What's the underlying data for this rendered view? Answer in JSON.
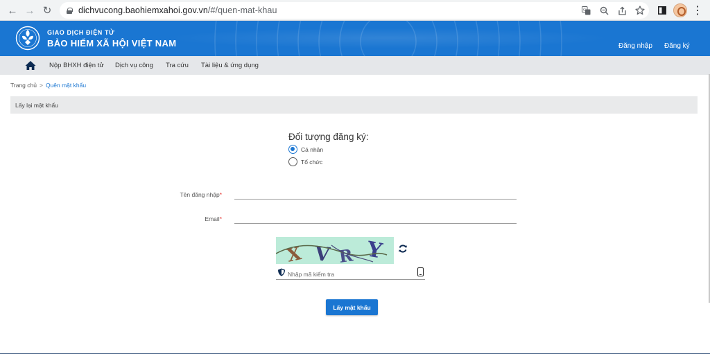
{
  "browser": {
    "url_host": "dichvucong.baohiemxahoi.gov.vn",
    "url_path": "/#/quen-mat-khau",
    "back_glyph": "←",
    "forward_glyph": "→",
    "reload_glyph": "↻",
    "menu_glyph": "⋮"
  },
  "header": {
    "brand_line1": "GIAO DỊCH ĐIỆN TỬ",
    "brand_line2": "BẢO HIỂM XÃ HỘI VIỆT NAM",
    "login": "Đăng nhập",
    "register": "Đăng ký",
    "color": "#1a76d2"
  },
  "menu": {
    "items": [
      "Nộp BHXH điện tử",
      "Dịch vụ công",
      "Tra cứu",
      "Tài liệu & ứng dụng"
    ]
  },
  "breadcrumb": {
    "home": "Trang chủ",
    "separator": ">",
    "current": "Quên mật khẩu"
  },
  "panel": {
    "title": "Lấy lại mật khẩu"
  },
  "form": {
    "reg_title": "Đối tượng đăng ký:",
    "options": [
      {
        "label": "Cá nhân",
        "checked": true
      },
      {
        "label": "Tổ chức",
        "checked": false
      }
    ],
    "username_label": "Tên đăng nhập",
    "email_label": "Email",
    "required_mark": "*",
    "username_value": "",
    "email_value": "",
    "captcha_text": "XVRY",
    "captcha_placeholder": "Nhập mã kiểm tra",
    "submit_label": "Lấy mật khẩu"
  }
}
